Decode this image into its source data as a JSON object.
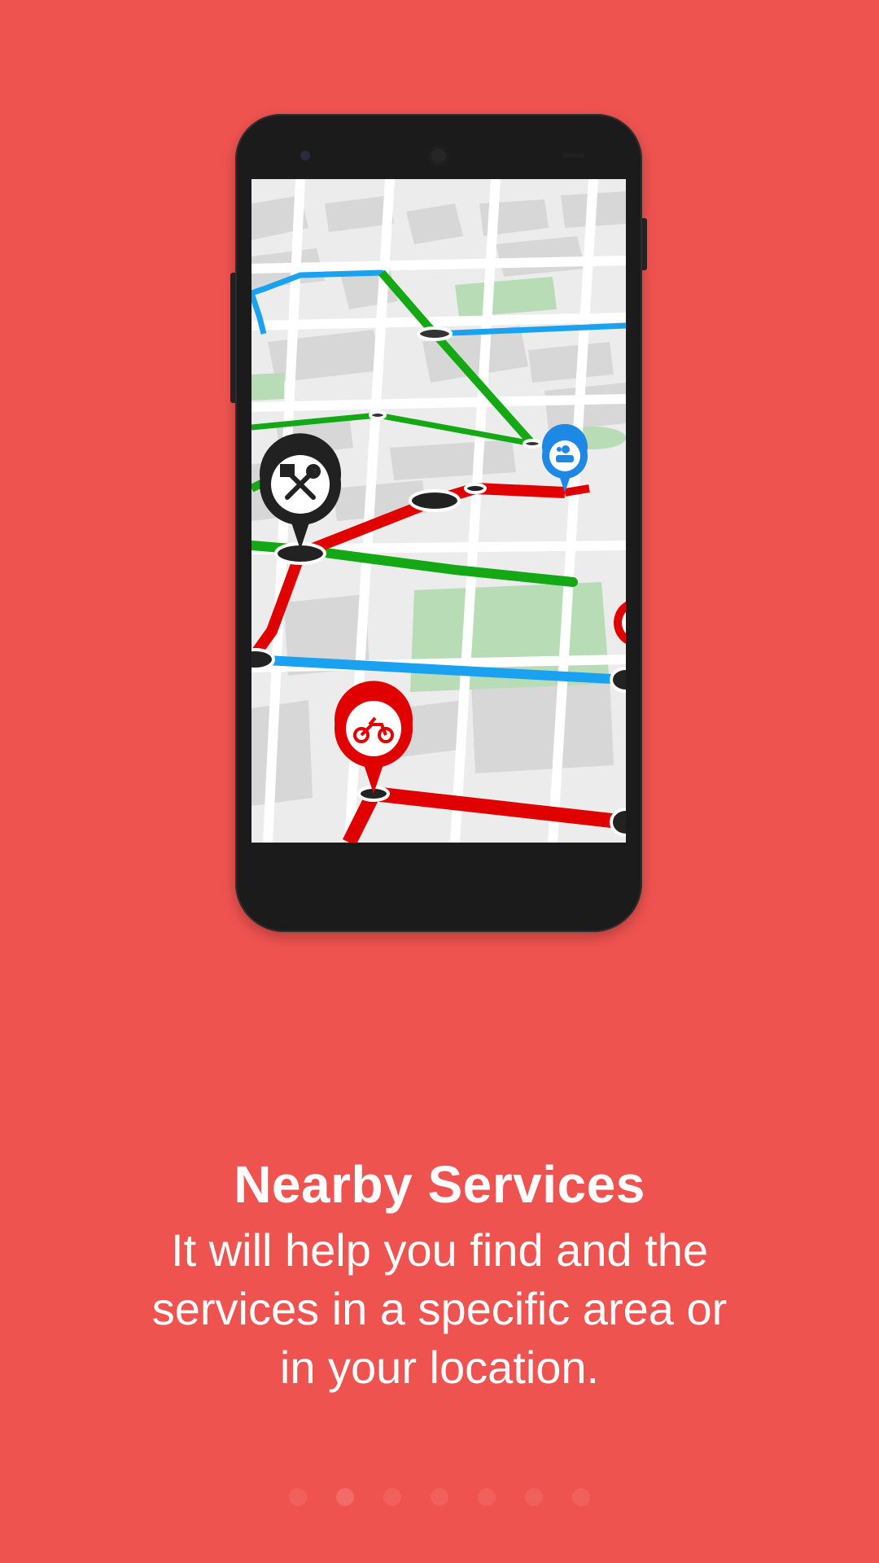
{
  "onboarding": {
    "title": "Nearby Services",
    "description": "It will help you find and the services in a specific area or in your location.",
    "background_color": "#EF5350",
    "page_count": 7,
    "active_page": 1
  },
  "illustration": {
    "device": "smartphone",
    "pins": [
      {
        "icon": "tools-icon",
        "color": "#212121"
      },
      {
        "icon": "car-wash-icon",
        "color": "#1E88E5"
      },
      {
        "icon": "motorcycle-icon",
        "color": "#E00000"
      }
    ],
    "route_colors": [
      "#E00000",
      "#1AA2F0",
      "#14A814"
    ]
  }
}
